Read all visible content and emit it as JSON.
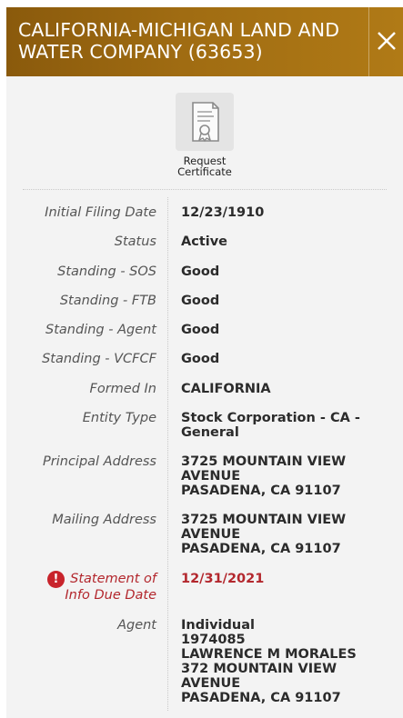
{
  "header": {
    "title": "CALIFORNIA-MICHIGAN LAND AND WATER COMPANY (63653)",
    "close_icon": "close-icon"
  },
  "certificate": {
    "label": "Request Certificate",
    "icon": "certificate-icon"
  },
  "details": [
    {
      "label": "Initial Filing Date",
      "value": [
        "12/23/1910"
      ]
    },
    {
      "label": "Status",
      "value": [
        "Active"
      ]
    },
    {
      "label": "Standing - SOS",
      "value": [
        "Good"
      ]
    },
    {
      "label": "Standing - FTB",
      "value": [
        "Good"
      ]
    },
    {
      "label": "Standing - Agent",
      "value": [
        "Good"
      ]
    },
    {
      "label": "Standing - VCFCF",
      "value": [
        "Good"
      ]
    },
    {
      "label": "Formed In",
      "value": [
        "CALIFORNIA"
      ]
    },
    {
      "label": "Entity Type",
      "value": [
        "Stock Corporation - CA -",
        "General"
      ]
    },
    {
      "label": "Principal Address",
      "value": [
        "3725 MOUNTAIN VIEW",
        "AVENUE",
        "PASADENA, CA 91107"
      ]
    },
    {
      "label": "Mailing Address",
      "value": [
        "3725 MOUNTAIN VIEW",
        "AVENUE",
        "PASADENA, CA 91107"
      ]
    },
    {
      "label": [
        "Statement of",
        "Info Due Date"
      ],
      "value": [
        "12/31/2021"
      ],
      "warning": true,
      "warning_icon": "exclamation-icon"
    },
    {
      "label": "Agent",
      "value": [
        "Individual",
        "1974085",
        "LAWRENCE M MORALES",
        "372 MOUNTAIN VIEW",
        "AVENUE",
        "PASADENA, CA  91107"
      ]
    }
  ],
  "colors": {
    "header_start": "#8a5a0c",
    "header_end": "#b07a16",
    "warning": "#b3272d"
  }
}
